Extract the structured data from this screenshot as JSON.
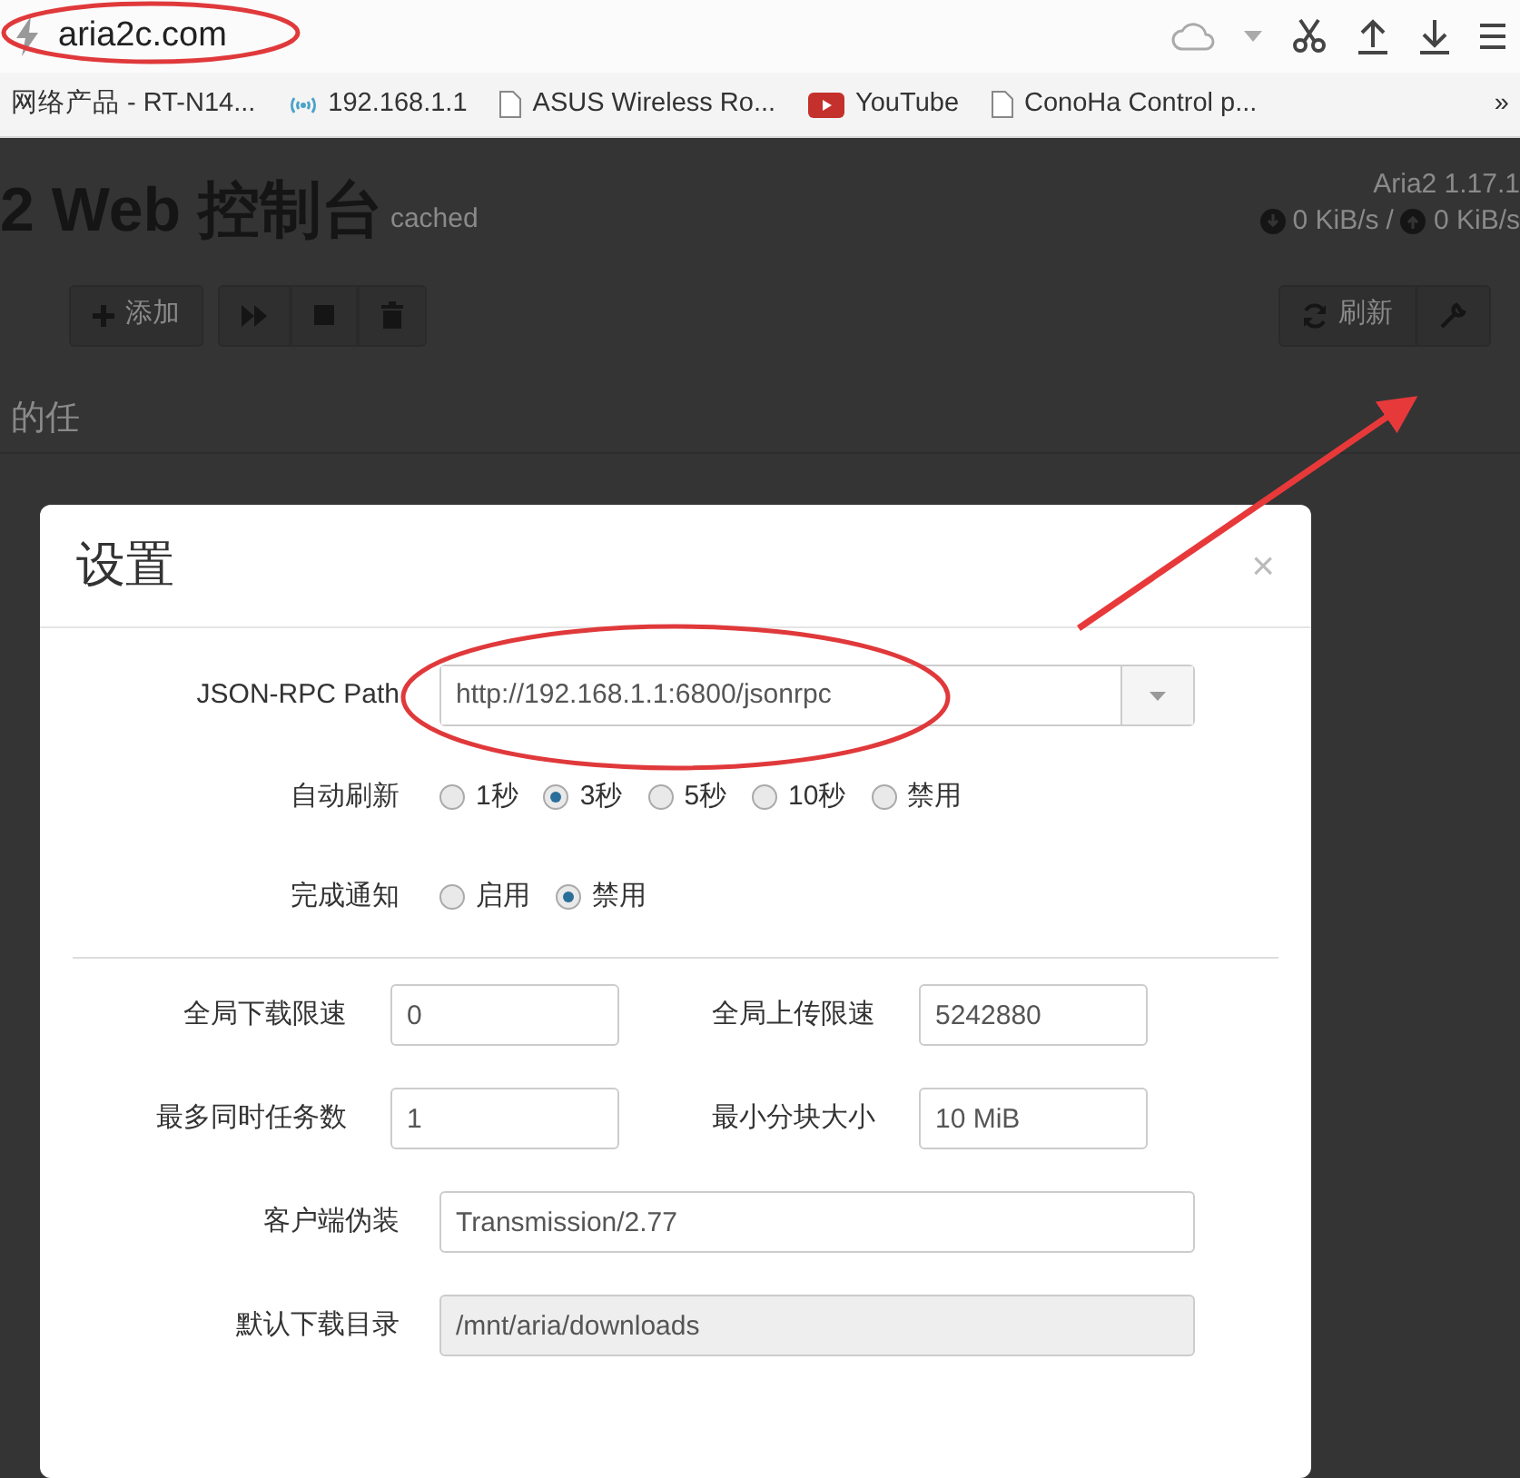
{
  "browser": {
    "address": "aria2c.com",
    "bookmarks": [
      {
        "label": "网络产品 - RT-N14...",
        "kind": "plain"
      },
      {
        "label": "192.168.1.1",
        "kind": "wireless"
      },
      {
        "label": "ASUS Wireless Ro...",
        "kind": "page"
      },
      {
        "label": "YouTube",
        "kind": "video"
      },
      {
        "label": "ConoHa Control p...",
        "kind": "page"
      }
    ],
    "overflow": "»"
  },
  "page": {
    "title": "2 Web 控制台",
    "badge": "cached",
    "version": "Aria2 1.17.1",
    "download_speed": "0 KiB/s",
    "separator": "/",
    "upload_speed": "0 KiB/s",
    "add_button": "添加",
    "refresh_button": "刷新",
    "section_heading": "的任"
  },
  "modal": {
    "title": "设置",
    "close": "×",
    "rpc_label": "JSON-RPC Path",
    "rpc_value": "http://192.168.1.1:6800/jsonrpc",
    "radio_groups": [
      {
        "label": "自动刷新",
        "options": [
          {
            "label": "1秒",
            "selected": false
          },
          {
            "label": "3秒",
            "selected": true
          },
          {
            "label": "5秒",
            "selected": false
          },
          {
            "label": "10秒",
            "selected": false
          },
          {
            "label": "禁用",
            "selected": false
          }
        ]
      },
      {
        "label": "完成通知",
        "options": [
          {
            "label": "启用",
            "selected": false
          },
          {
            "label": "禁用",
            "selected": true
          }
        ]
      }
    ],
    "fields": [
      {
        "label": "全局下载限速",
        "value": "0",
        "kind": "half",
        "disabled": false
      },
      {
        "label": "全局上传限速",
        "value": "5242880",
        "kind": "half",
        "disabled": false
      },
      {
        "label": "最多同时任务数",
        "value": "1",
        "kind": "half",
        "disabled": false
      },
      {
        "label": "最小分块大小",
        "value": "10 MiB",
        "kind": "half",
        "disabled": false
      },
      {
        "label": "客户端伪装",
        "value": "Transmission/2.77",
        "kind": "full",
        "disabled": false
      },
      {
        "label": "默认下载目录",
        "value": "/mnt/aria/downloads",
        "kind": "full",
        "disabled": true
      }
    ]
  }
}
